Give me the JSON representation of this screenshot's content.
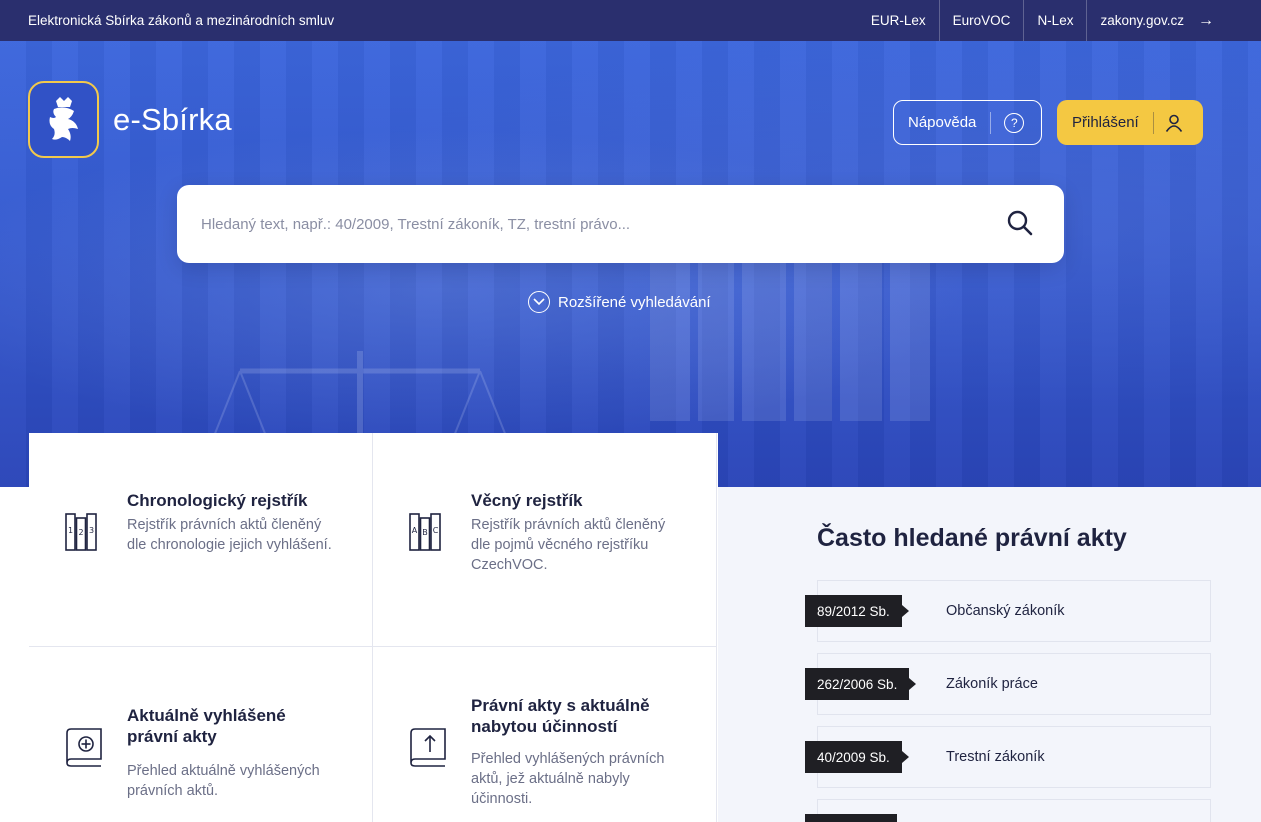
{
  "topbar": {
    "title": "Elektronická Sbírka zákonů a mezinárodních smluv",
    "links": [
      "EUR-Lex",
      "EuroVOC",
      "N-Lex",
      "zakony.gov.cz"
    ],
    "arrow": "→"
  },
  "header": {
    "logo_text": "e-Sbírka",
    "help_label": "Nápověda",
    "help_icon": "?",
    "login_label": "Přihlášení"
  },
  "search": {
    "placeholder": "Hledaný text, např.: 40/2009, Trestní zákoník, TZ, trestní právo...",
    "advanced_label": "Rozšířené vyhledávání"
  },
  "cards": [
    {
      "title": "Chronologický rejstřík",
      "text": "Rejstřík právních aktů členěný dle chronologie jejich vyhlášení.",
      "icon": "chronological-register-icon"
    },
    {
      "title": "Věcný rejstřík",
      "text": "Rejstřík právních aktů členěný dle pojmů věcného rejstříku CzechVOC.",
      "icon": "subject-register-icon"
    },
    {
      "title": "Aktuálně vyhlášené právní akty",
      "text": "Přehled aktuálně vyhlášených právních aktů.",
      "icon": "book-plus-icon"
    },
    {
      "title": "Právní akty s aktuálně nabytou účinností",
      "text": "Přehled vyhlášených právních aktů, jež aktuálně nabyly účinnosti.",
      "icon": "book-arrow-up-icon"
    }
  ],
  "frequent": {
    "title": "Často hledané právní akty",
    "items": [
      {
        "tag": "89/2012 Sb.",
        "name": "Občanský zákoník"
      },
      {
        "tag": "262/2006 Sb.",
        "name": "Zákoník práce"
      },
      {
        "tag": "40/2009 Sb.",
        "name": "Trestní zákoník"
      }
    ]
  },
  "colors": {
    "topbar": "#2a2f6e",
    "hero": "#3459cf",
    "accent": "#f4c842",
    "text": "#1f2340"
  }
}
